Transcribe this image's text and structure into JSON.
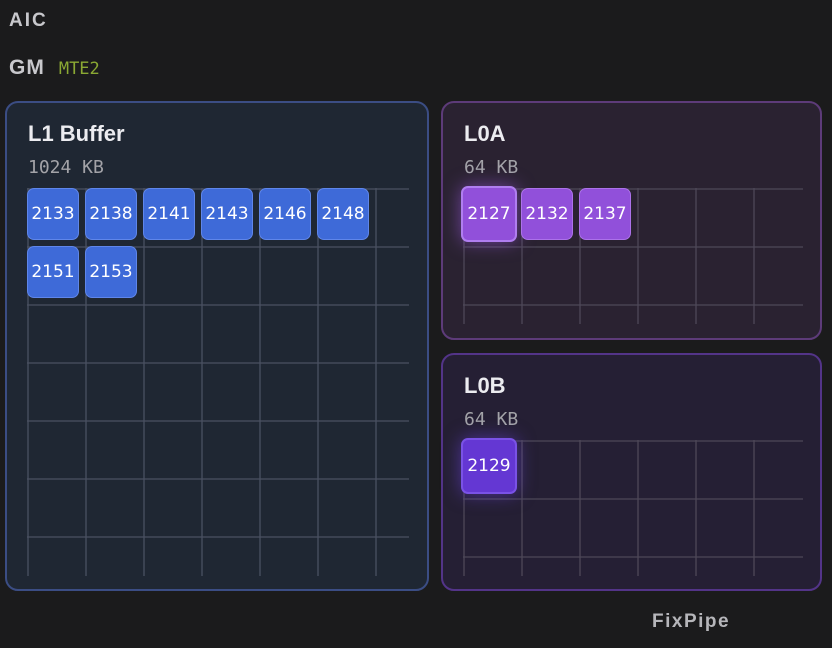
{
  "header": {
    "title": "AIC"
  },
  "gm": {
    "label": "GM",
    "pipe": "MTE2"
  },
  "footer": {
    "label": "FixPipe"
  },
  "panels": {
    "l1": {
      "title": "L1 Buffer",
      "size": "1024 KB",
      "tiles": [
        "2133",
        "2138",
        "2141",
        "2143",
        "2146",
        "2148",
        "2151",
        "2153"
      ]
    },
    "l0a": {
      "title": "L0A",
      "size": "64 KB",
      "tiles": [
        "2127",
        "2132",
        "2137"
      ]
    },
    "l0b": {
      "title": "L0B",
      "size": "64 KB",
      "tiles": [
        "2129"
      ]
    }
  },
  "colors": {
    "background": "#1b1b1c",
    "l1_tile": "#3e6ad8",
    "l0a_tile": "#9150da",
    "l0b_tile": "#6437d3",
    "mte_label": "#8aa833"
  }
}
